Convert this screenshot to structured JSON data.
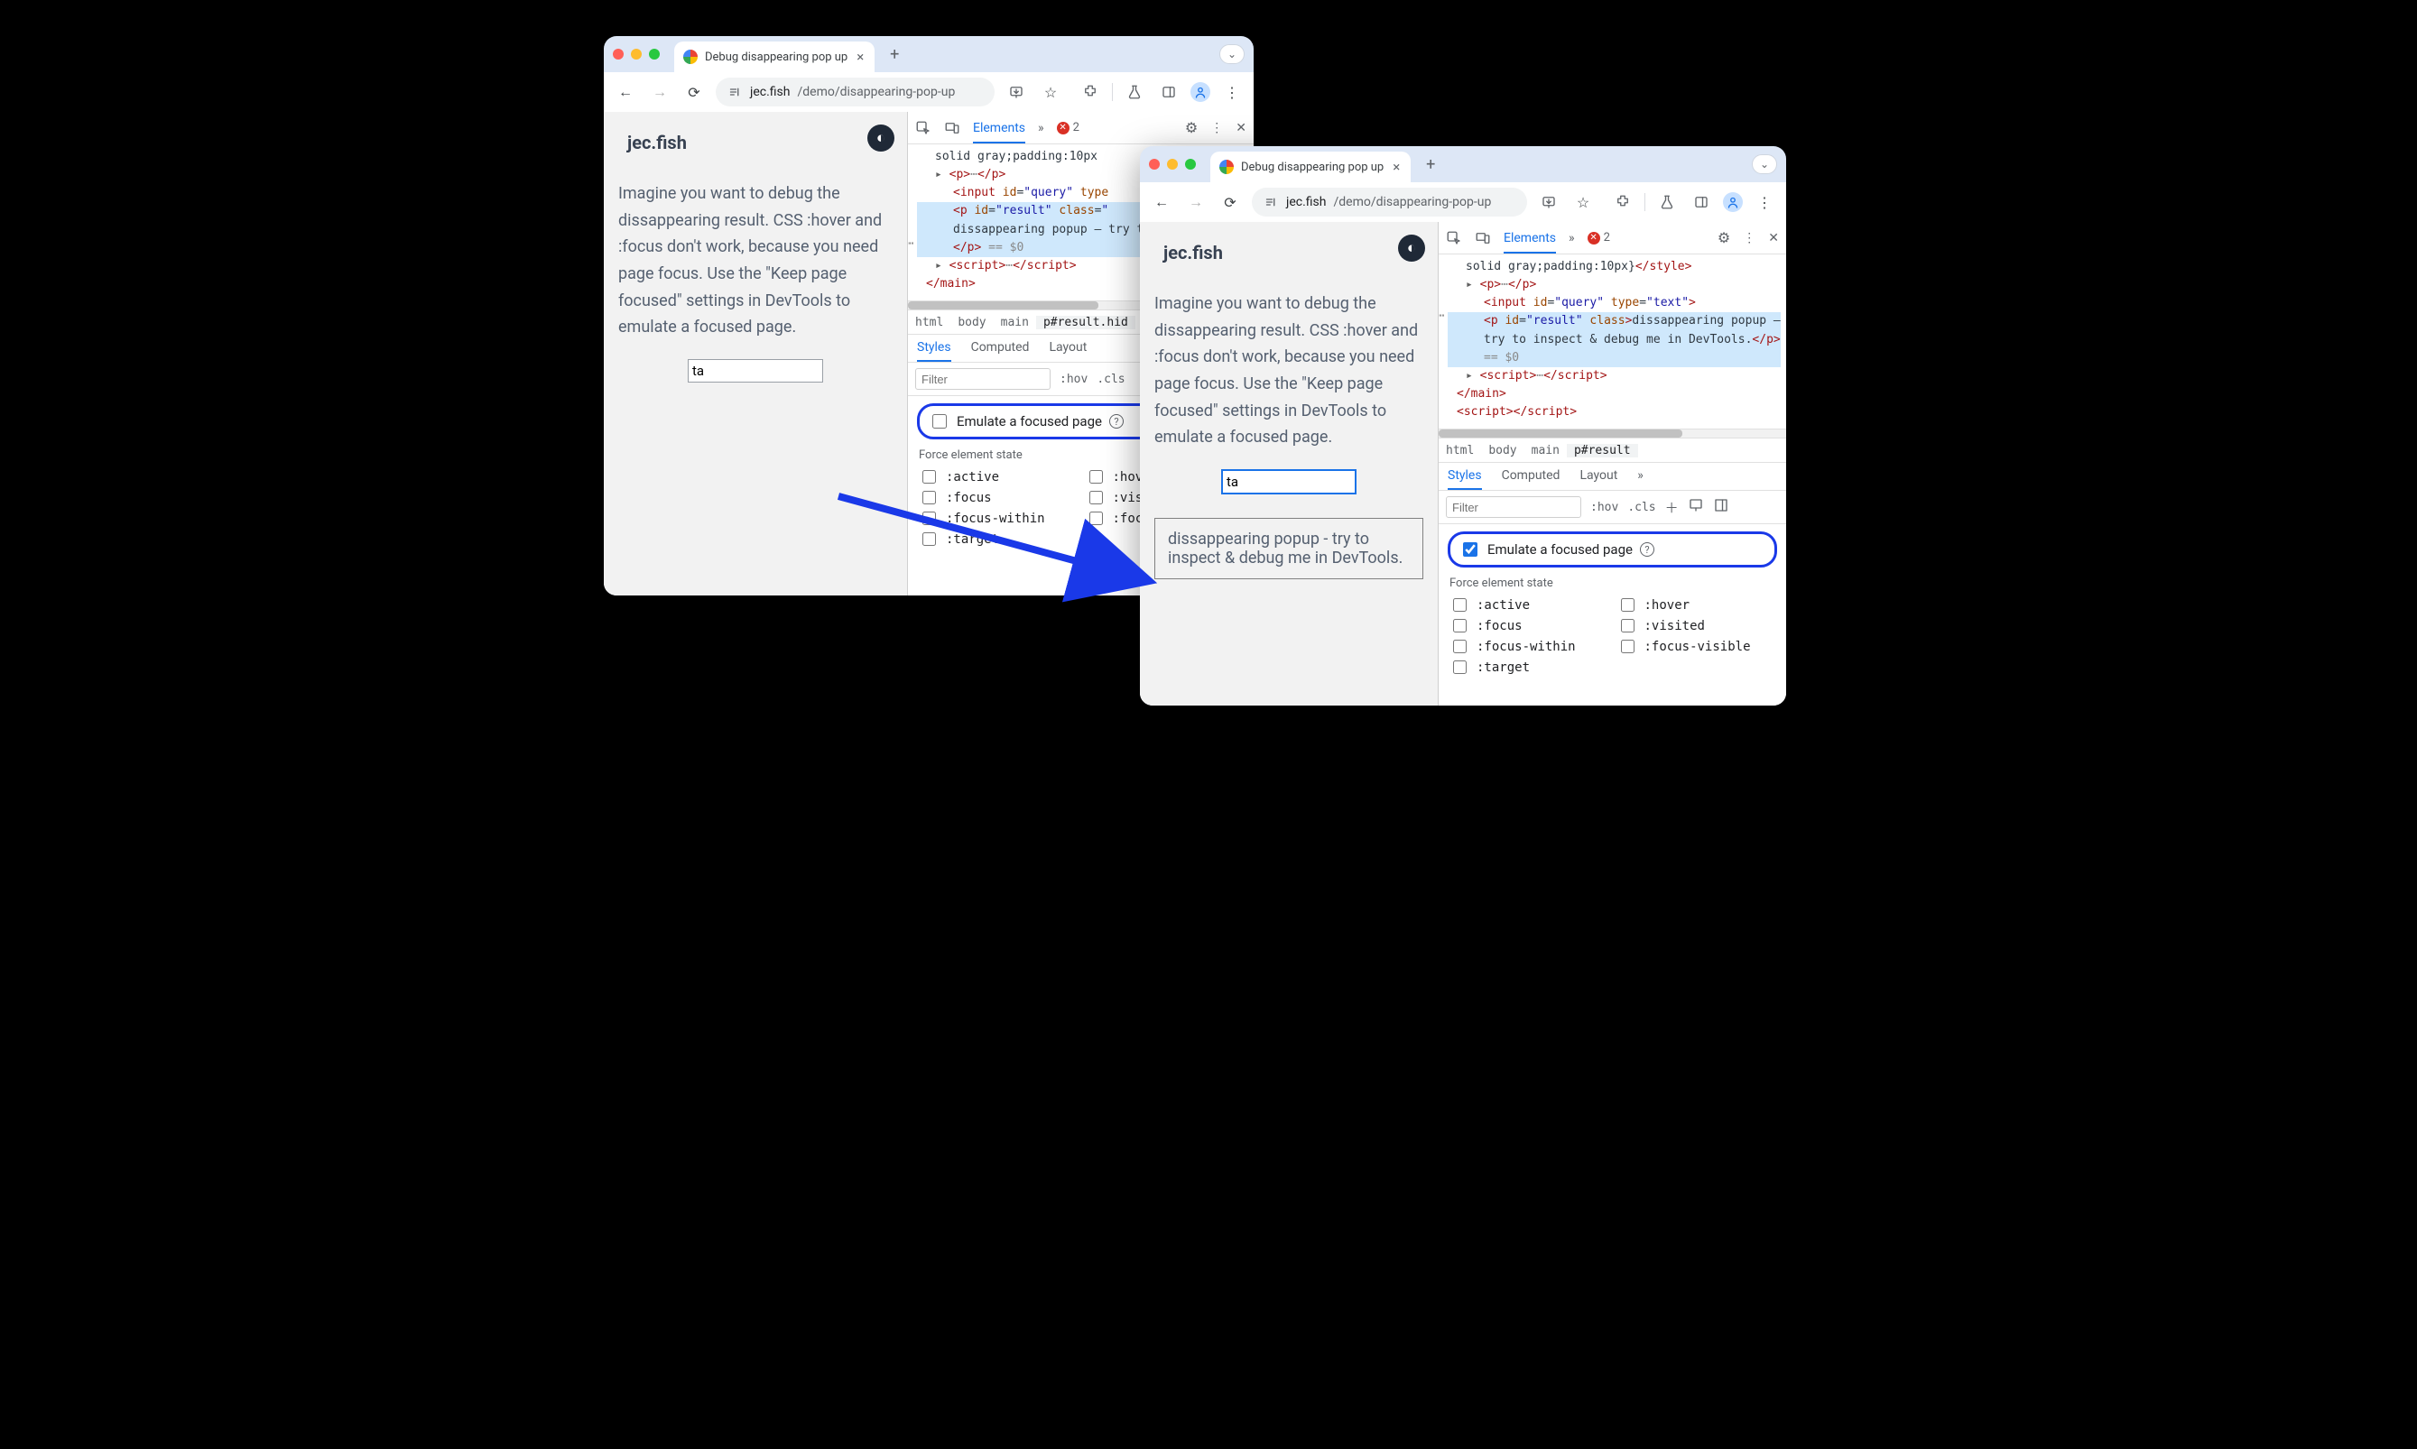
{
  "browser": {
    "tabTitle": "Debug disappearing pop up",
    "url_host": "jec.fish",
    "url_path": "/demo/disappearing-pop-up"
  },
  "page": {
    "brand": "jec.fish",
    "bodyText": "Imagine you want to debug the dissappearing result. CSS :hover and :focus don't work, because you need page focus. Use the \"Keep page focused\" settings in DevTools to emulate a focused page.",
    "inputValue": "ta",
    "popupText": "dissappearing popup - try to inspect & debug me in DevTools."
  },
  "devtools": {
    "panels": {
      "elements": "Elements"
    },
    "errorCount": "2",
    "domPrefix": "solid gray;padding:10px}",
    "domLines": {
      "style1": "solid gray;padding:10px",
      "style2": "solid gray;padding:10px}",
      "inputId": "query",
      "inputType": "text",
      "resultId": "result",
      "resultTextA": "dissappearing popup – try to inspect & debug me in",
      "resultTextB": "dissappearing popup – try to inspect & debug me in DevTools.",
      "eqSel": " == $0"
    },
    "crumbs1": [
      "html",
      "body",
      "main",
      "p#result.hid"
    ],
    "crumbs2": [
      "html",
      "body",
      "main",
      "p#result"
    ],
    "styleTabs": {
      "styles": "Styles",
      "computed": "Computed",
      "layout": "Layout"
    },
    "filterPlaceholder": "Filter",
    "hov": ":hov",
    "cls": ".cls",
    "emulateLabel": "Emulate a focused page",
    "forceHeader": "Force element state",
    "states": {
      "active": ":active",
      "hover": ":hover",
      "focus": ":focus",
      "visited": ":visited",
      "focusWithin": ":focus-within",
      "focusVisible": ":focus-visible",
      "target": ":target",
      "visi": ":visi",
      "focu": ":focu",
      "hove": ":hove"
    }
  }
}
